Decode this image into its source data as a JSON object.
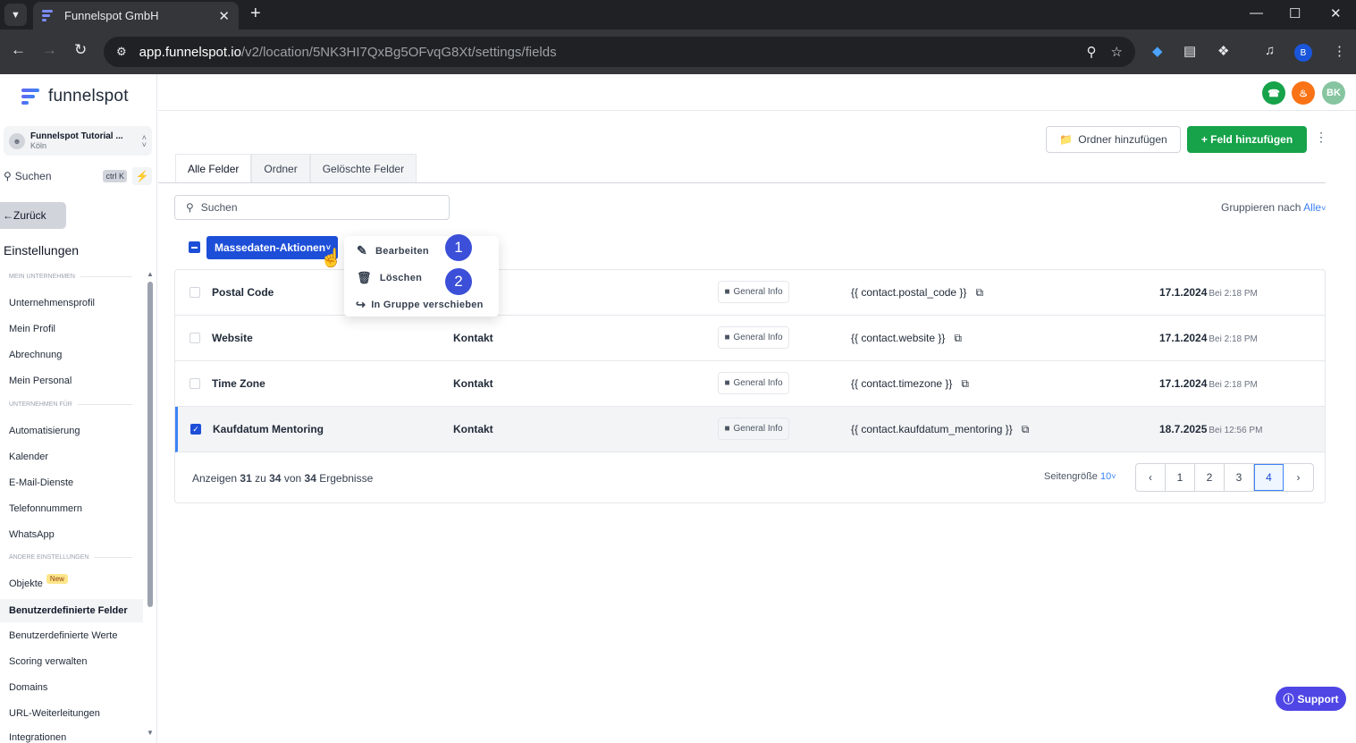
{
  "browser": {
    "tab_title": "Funnelspot GmbH",
    "url_host": "app.funnelspot.io",
    "url_path": "/v2/location/5NK3HI7QxBg5OFvqG8Xt/settings/fields",
    "profile_initial": "B"
  },
  "sidebar": {
    "logo_text": "funnelspot",
    "location_name": "Funnelspot Tutorial ...",
    "location_city": "Köln",
    "search_label": "Suchen",
    "search_shortcut": "ctrl K",
    "back_label": "Zurück",
    "title": "Einstellungen",
    "sections": [
      {
        "label": "MEIN UNTERNEHMEN"
      },
      {
        "label": "UNTERNEHMEN FÜR"
      },
      {
        "label": "ANDERE EINSTELLUNGEN"
      }
    ],
    "items": [
      {
        "label": "Unternehmensprofil"
      },
      {
        "label": "Mein Profil"
      },
      {
        "label": "Abrechnung"
      },
      {
        "label": "Mein Personal"
      },
      {
        "label": "Automatisierung"
      },
      {
        "label": "Kalender"
      },
      {
        "label": "E-Mail-Dienste"
      },
      {
        "label": "Telefonnummern"
      },
      {
        "label": "WhatsApp"
      },
      {
        "label": "Objekte",
        "badge": "New"
      },
      {
        "label": "Benutzerdefinierte Felder",
        "active": true
      },
      {
        "label": "Benutzerdefinierte Werte"
      },
      {
        "label": "Scoring verwalten"
      },
      {
        "label": "Domains"
      },
      {
        "label": "URL-Weiterleitungen"
      },
      {
        "label": "Integrationen"
      }
    ]
  },
  "topbar": {
    "avatar_initials": "BK"
  },
  "main": {
    "add_folder_label": "Ordner hinzufügen",
    "add_field_label": "+ Feld hinzufügen",
    "tabs": [
      {
        "label": "Alle Felder",
        "active": true
      },
      {
        "label": "Ordner"
      },
      {
        "label": "Gelöschte Felder"
      }
    ],
    "search_placeholder": "Suchen",
    "group_by_label": "Gruppieren nach",
    "group_by_value": "Alle",
    "bulk_actions_label": "Massedaten-Aktionen",
    "bulk_menu": [
      {
        "label": "Bearbeiten",
        "icon": "pencil-icon"
      },
      {
        "label": "Löschen",
        "icon": "trash-icon"
      },
      {
        "label": "In Gruppe verschieben",
        "icon": "move-to-group-icon"
      }
    ],
    "markers": [
      "1",
      "2"
    ],
    "rows": [
      {
        "name": "Postal Code",
        "object": "",
        "folder": "General Info",
        "key": "{{ contact.postal_code }}",
        "date": "17.1.2024",
        "time": "Bei 2:18 PM",
        "checked": false
      },
      {
        "name": "Website",
        "object": "Kontakt",
        "folder": "General Info",
        "key": "{{ contact.website }}",
        "date": "17.1.2024",
        "time": "Bei 2:18 PM",
        "checked": false
      },
      {
        "name": "Time Zone",
        "object": "Kontakt",
        "folder": "General Info",
        "key": "{{ contact.timezone }}",
        "date": "17.1.2024",
        "time": "Bei 2:18 PM",
        "checked": false
      },
      {
        "name": "Kaufdatum Mentoring",
        "object": "Kontakt",
        "folder": "General Info",
        "key": "{{ contact.kaufdatum_mentoring }}",
        "date": "18.7.2025",
        "time": "Bei 12:56 PM",
        "checked": true
      }
    ],
    "results_prefix": "Anzeigen",
    "results_from": "31",
    "results_to_word": "zu",
    "results_to": "34",
    "results_of_word": "von",
    "results_total": "34",
    "results_suffix": "Ergebnisse",
    "page_size_label": "Seitengröße",
    "page_size_value": "10",
    "pages": [
      "1",
      "2",
      "3",
      "4"
    ],
    "current_page": "4"
  },
  "support_label": "Support",
  "colors": {
    "primary": "#1d4ed8",
    "success": "#16a34a",
    "marker": "#3b4fd8",
    "support": "#4f46e5"
  }
}
